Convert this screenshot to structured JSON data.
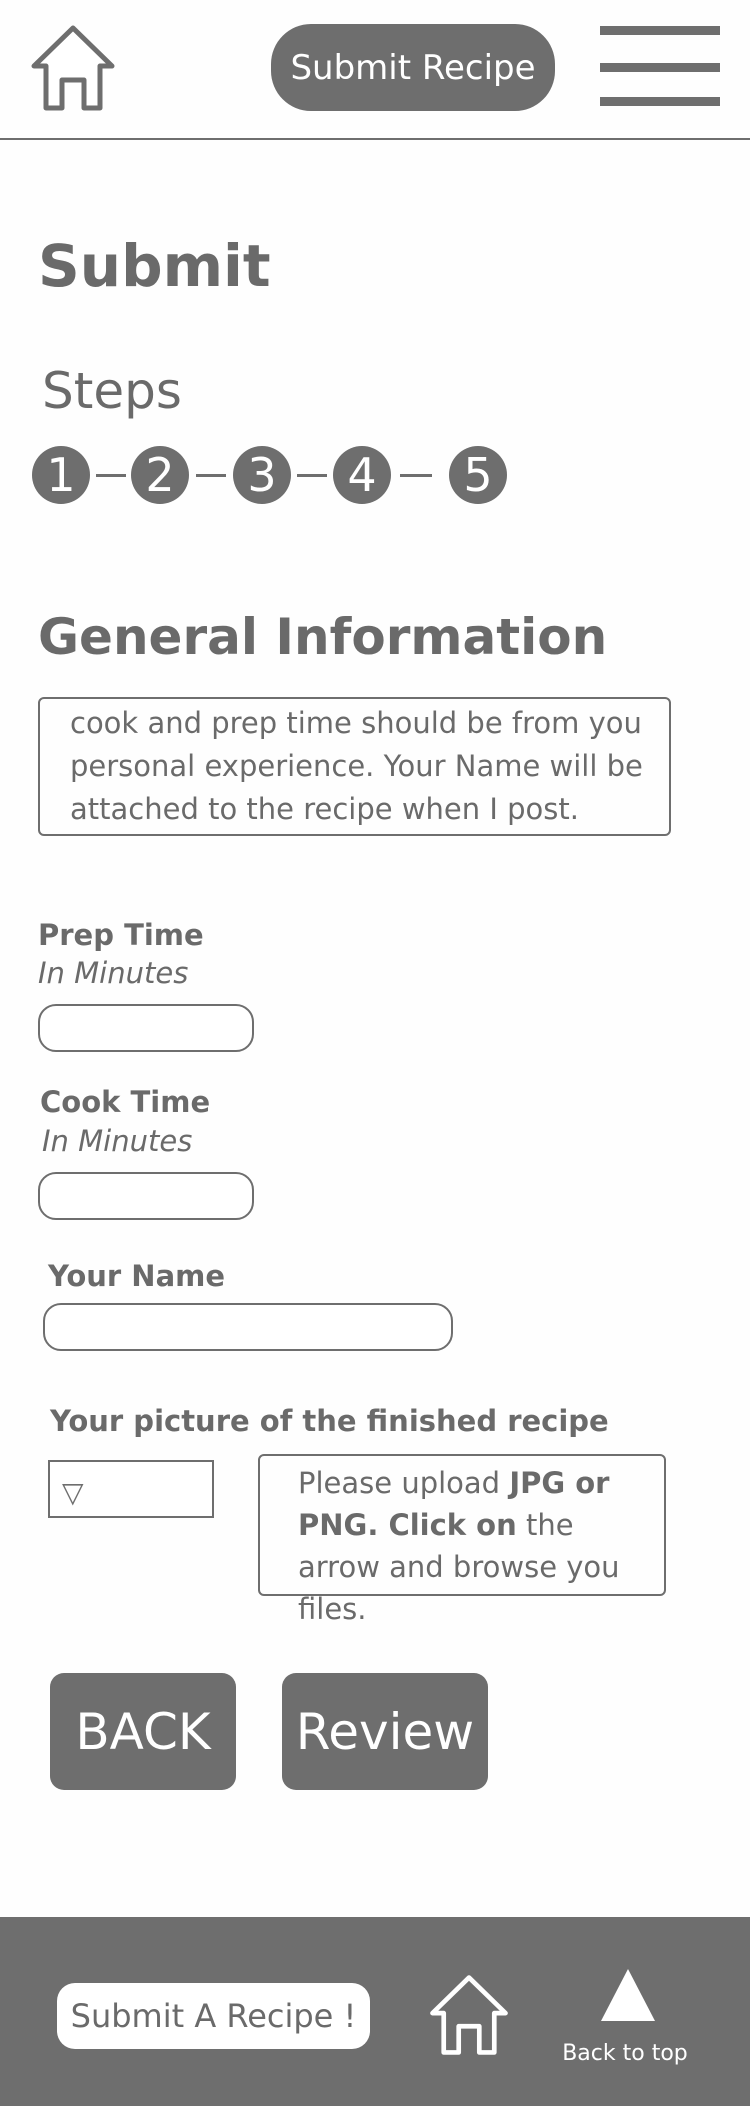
{
  "header": {
    "submit_button": "Submit Recipe",
    "home_icon": "home-icon",
    "menu_icon": "hamburger-menu-icon"
  },
  "page": {
    "title": "Submit",
    "steps_label": "Steps",
    "steps": [
      "1",
      "2",
      "3",
      "4",
      "5"
    ],
    "section_title": "General Information",
    "info_text": "cook and prep time should be from you personal experience. Your Name will be attached to the recipe when I post."
  },
  "form": {
    "prep_time": {
      "label": "Prep Time",
      "hint": "In Minutes",
      "value": ""
    },
    "cook_time": {
      "label": "Cook Time",
      "hint": "In Minutes",
      "value": ""
    },
    "your_name": {
      "label": "Your Name",
      "value": ""
    },
    "picture": {
      "label": "Your picture of the finished recipe",
      "select_icon": "dropdown-triangle-icon",
      "note_prefix": "Please upload ",
      "note_bold": "JPG or PNG. Click on",
      "note_suffix": " the arrow and browse you files."
    }
  },
  "actions": {
    "back": "BACK",
    "review": "Review"
  },
  "footer": {
    "submit_button": "Submit A Recipe !",
    "home_icon": "home-icon",
    "back_to_top": "Back to top"
  },
  "colors": {
    "primary_gray": "#6e6e6e",
    "background": "#fefefe",
    "on_primary": "#ffffff"
  }
}
